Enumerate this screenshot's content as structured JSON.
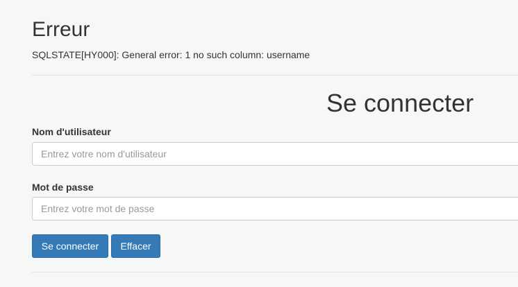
{
  "error": {
    "title": "Erreur",
    "message": "SQLSTATE[HY000]: General error: 1 no such column: username"
  },
  "login": {
    "title": "Se connecter",
    "username": {
      "label": "Nom d'utilisateur",
      "placeholder": "Entrez votre nom d'utilisateur",
      "value": ""
    },
    "password": {
      "label": "Mot de passe",
      "placeholder": "Entrez votre mot de passe",
      "value": ""
    },
    "buttons": {
      "submit_label": "Se connecter",
      "reset_label": "Effacer"
    }
  },
  "colors": {
    "page_background": "#f5f8f7",
    "primary_button": "#337ab7",
    "text": "#333333"
  }
}
